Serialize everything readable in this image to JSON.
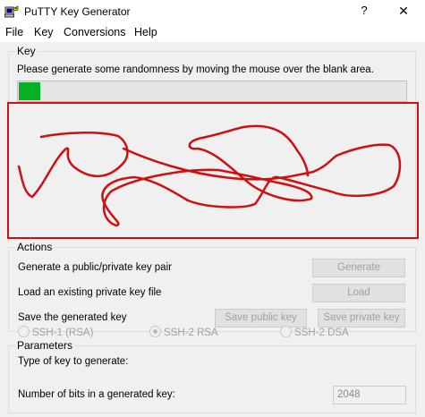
{
  "window": {
    "title": "PuTTY Key Generator",
    "help_glyph": "?",
    "close_glyph": "✕"
  },
  "menu": [
    "File",
    "Key",
    "Conversions",
    "Help"
  ],
  "key_group": {
    "label": "Key",
    "instruction": "Please generate some randomness by moving the mouse over the blank area.",
    "progress_fraction": 0.055,
    "progress_color": "#06b025",
    "highlight_color": "#d01010"
  },
  "actions": {
    "label": "Actions",
    "generate_text": "Generate a public/private key pair",
    "generate_button": "Generate",
    "load_text": "Load an existing private key file",
    "load_button": "Load",
    "save_text": "Save the generated key",
    "save_public_button": "Save public key",
    "save_private_button": "Save private key"
  },
  "parameters": {
    "label": "Parameters",
    "type_label": "Type of key to generate:",
    "options": [
      {
        "label": "SSH-1 (RSA)",
        "checked": false
      },
      {
        "label": "SSH-2 RSA",
        "checked": true
      },
      {
        "label": "SSH-2 DSA",
        "checked": false
      }
    ],
    "bits_label": "Number of bits in a generated key:",
    "bits_value": "2048"
  }
}
